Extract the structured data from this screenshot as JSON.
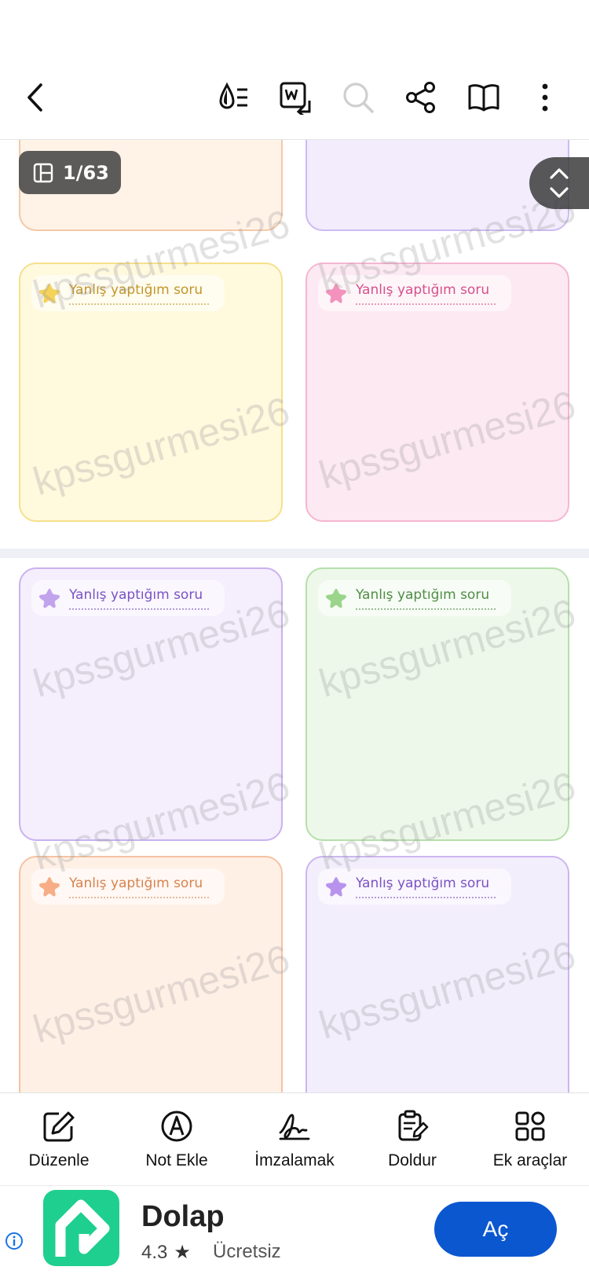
{
  "toolbar": {
    "icons": [
      "back-icon",
      "reading-mode-icon",
      "word-convert-icon",
      "search-icon",
      "share-icon",
      "book-icon",
      "more-icon"
    ]
  },
  "viewer": {
    "page_indicator": "1/63"
  },
  "card_label": "Yanlış yaptığım soru",
  "watermark": "kpssgurmesi26",
  "cards": [
    {
      "border": "#f3c9a8",
      "fill": "#fff2e6",
      "star": "#f7b98e",
      "text": "#d28a55",
      "show_label": false
    },
    {
      "border": "#cdbbf2",
      "fill": "#f2ecfd",
      "star": "#c2a8f0",
      "text": "#7b5cc4",
      "show_label": false
    },
    {
      "border": "#f6e08b",
      "fill": "#fff9de",
      "star": "#f5d35a",
      "text": "#c29528",
      "show_label": true
    },
    {
      "border": "#f5b6d1",
      "fill": "#fde9f2",
      "star": "#f392bd",
      "text": "#d6508c",
      "show_label": true
    },
    {
      "border": "#c9b2ef",
      "fill": "#f4eefd",
      "star": "#c1a3ee",
      "text": "#7a52c2",
      "show_label": true
    },
    {
      "border": "#b5dfab",
      "fill": "#eef8ea",
      "star": "#9bd58c",
      "text": "#4f8d44",
      "show_label": true
    },
    {
      "border": "#f6c2a2",
      "fill": "#fff0e6",
      "star": "#f7ad85",
      "text": "#d7834f",
      "show_label": true
    },
    {
      "border": "#cbb6f0",
      "fill": "#f3eefc",
      "star": "#b793ee",
      "text": "#7a52c2",
      "show_label": true
    }
  ],
  "bottom_bar": {
    "items": [
      {
        "label": "Düzenle",
        "icon": "edit-icon"
      },
      {
        "label": "Not Ekle",
        "icon": "annotate-icon"
      },
      {
        "label": "İmzalamak",
        "icon": "signature-icon"
      },
      {
        "label": "Doldur",
        "icon": "fill-form-icon"
      },
      {
        "label": "Ek araçlar",
        "icon": "more-tools-icon"
      }
    ]
  },
  "ad": {
    "app_name": "Dolap",
    "rating": "4.3",
    "price": "Ücretsiz",
    "button": "Aç",
    "brand_color": "#1fcf8f",
    "button_color": "#0b57d0"
  }
}
